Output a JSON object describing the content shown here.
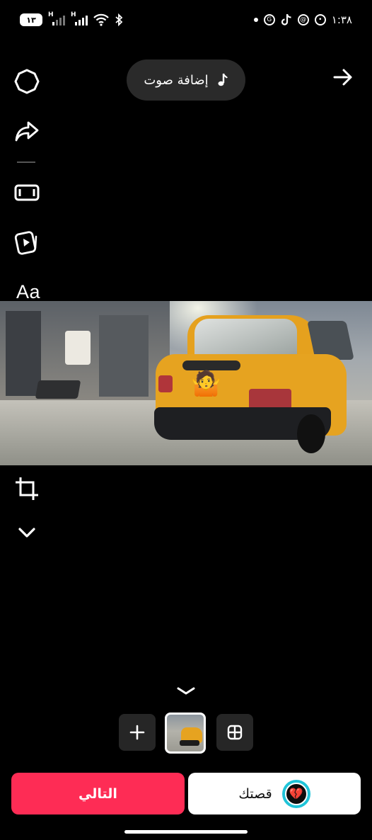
{
  "status_bar": {
    "time": "١:٣٨",
    "battery": "١٣",
    "network_1": "H",
    "network_2": "H"
  },
  "top": {
    "add_sound_label": "إضافة صوت"
  },
  "left_toolbar": {
    "text_tool_label": "Aa"
  },
  "media": {
    "sticker_emoji": "🤷"
  },
  "bottom": {
    "next_label": "التالي",
    "your_story_label": "قصتك",
    "story_avatar_emoji": "💔"
  },
  "colors": {
    "primary": "#fe2c55",
    "story_ring": "#20c4d8",
    "background": "#000000"
  }
}
